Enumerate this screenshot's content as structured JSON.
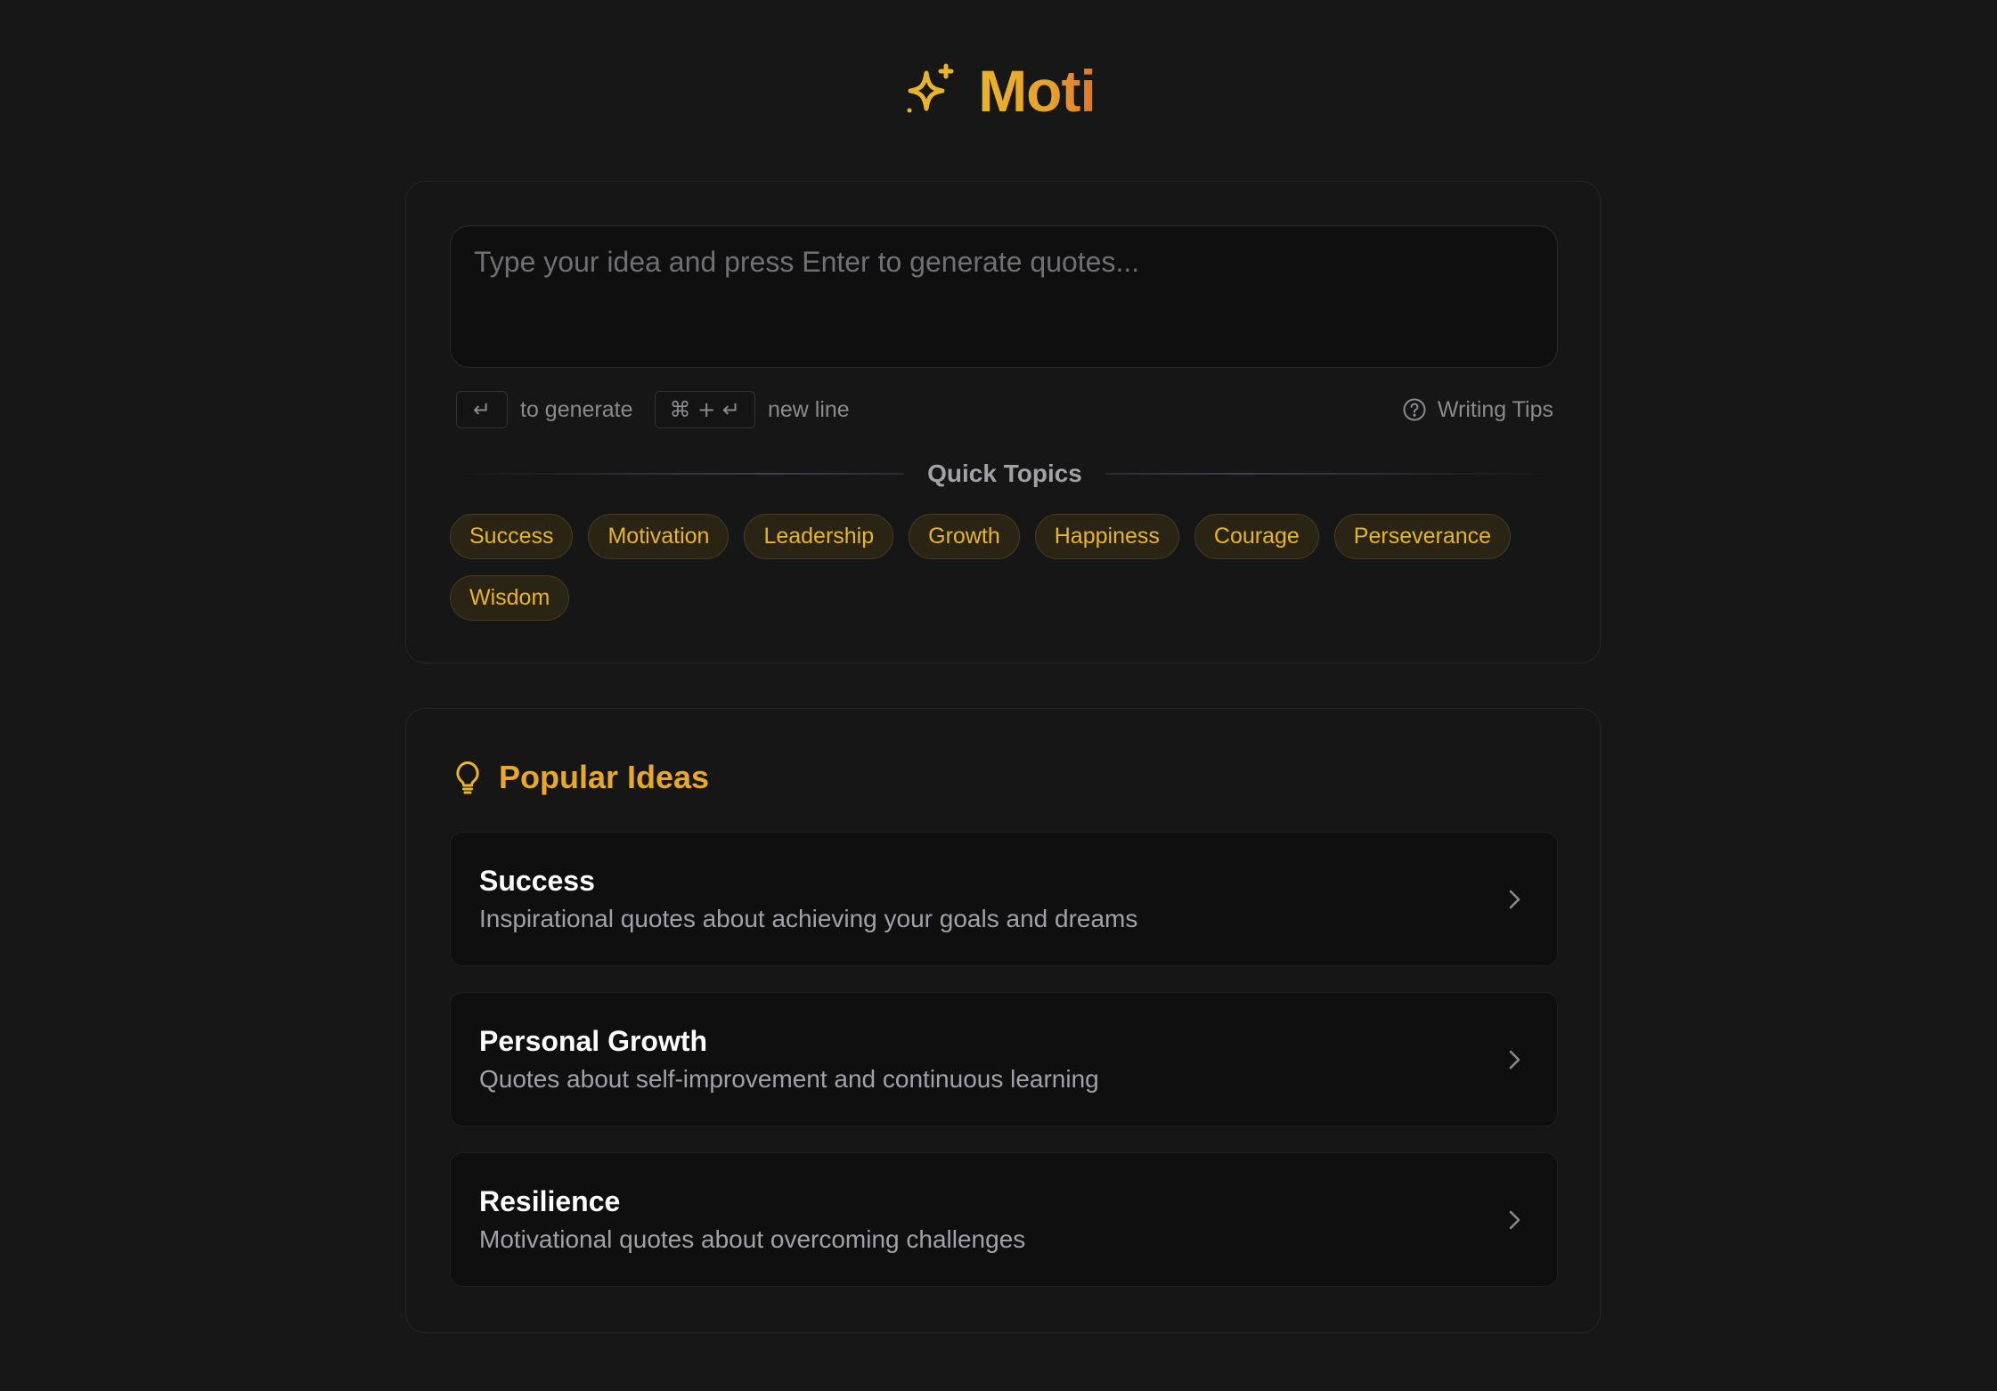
{
  "app": {
    "title": "Moti",
    "logo_icon": "sparkles-icon"
  },
  "composer": {
    "placeholder": "Type your idea and press Enter to generate quotes...",
    "value": "",
    "hint_enter_key": "↵",
    "hint_enter_label": "to generate",
    "hint_newline_key": "⌘ + ↵",
    "hint_newline_label": "new line",
    "tips_label": "Writing Tips"
  },
  "quick_topics": {
    "label": "Quick Topics",
    "items": [
      "Success",
      "Motivation",
      "Leadership",
      "Growth",
      "Happiness",
      "Courage",
      "Perseverance",
      "Wisdom"
    ]
  },
  "popular_ideas": {
    "title": "Popular Ideas",
    "items": [
      {
        "title": "Success",
        "description": "Inspirational quotes about achieving your goals and dreams"
      },
      {
        "title": "Personal Growth",
        "description": "Quotes about self-improvement and continuous learning"
      },
      {
        "title": "Resilience",
        "description": "Motivational quotes about overcoming challenges"
      }
    ]
  },
  "colors": {
    "background": "#171717",
    "card": "#161616",
    "accent": "#e8b42c",
    "accent_orange": "#e0752b",
    "muted_text": "#8a8a8e"
  }
}
